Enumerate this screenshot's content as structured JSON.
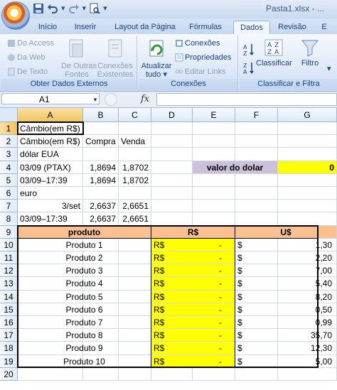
{
  "window": {
    "title": "Pasta1.xlsx - ..."
  },
  "quick_access": {
    "save_icon": "save-icon",
    "undo_icon": "undo-icon",
    "redo_icon": "redo-icon",
    "preview_icon": "print-preview-icon",
    "more_icon": "chevron-down-icon"
  },
  "tabs": [
    {
      "label": "Início"
    },
    {
      "label": "Inserir"
    },
    {
      "label": "Layout da Página"
    },
    {
      "label": "Fórmulas"
    },
    {
      "label": "Dados"
    },
    {
      "label": "Revisão"
    },
    {
      "label": "E"
    }
  ],
  "ribbon": {
    "group1": {
      "label": "Obter Dados Externos",
      "access": "Do Access",
      "web": "Da Web",
      "text": "De Texto",
      "other_line1": "De Outras",
      "other_line2": "Fontes",
      "existing_line1": "Conexões",
      "existing_line2": "Existentes"
    },
    "group2": {
      "label": "Conexões",
      "refresh_line1": "Atualizar",
      "refresh_line2": "tudo",
      "connections": "Conexões",
      "properties": "Propriedades",
      "edit_links": "Editar Links"
    },
    "group3": {
      "label": "Classificar e Filtra",
      "sort": "Classificar",
      "filter": "Filtro"
    }
  },
  "formula_bar": {
    "name_box": "A1",
    "fx": "fx",
    "formula": ""
  },
  "columns": [
    "A",
    "B",
    "C",
    "D",
    "E",
    "F",
    "G"
  ],
  "rows": [
    "1",
    "2",
    "3",
    "4",
    "5",
    "6",
    "7",
    "8",
    "9",
    "10",
    "11",
    "12",
    "13",
    "14",
    "15",
    "16",
    "17",
    "18",
    "19",
    "20"
  ],
  "sheet": {
    "a1": "Câmbio(em R$)",
    "a2": "Câmbio(em R$)",
    "b2": "Compra",
    "c2": "Venda",
    "a3": "dólar EUA",
    "a4": "03/09 (PTAX)",
    "b4": "1,8694",
    "c4": "1,8702",
    "a5": "03/09–17:39",
    "b5": "1,8694",
    "c5": "1,8702",
    "a6": "euro",
    "a7": "3/set",
    "b7": "2,6637",
    "c7": "2,6651",
    "a8": "03/09–17:39",
    "b8": "2,6637",
    "c8": "2,6651",
    "e4": "valor do dolar",
    "g4": "0"
  },
  "table": {
    "headers": [
      "produto",
      "R$",
      "U$"
    ],
    "rows": [
      {
        "produto": "Produto 1",
        "rs": "R$",
        "rs_val": "-",
        "us": "$",
        "us_val": "1,30"
      },
      {
        "produto": "Produto 2",
        "rs": "R$",
        "rs_val": "-",
        "us": "$",
        "us_val": "2,20"
      },
      {
        "produto": "Produto 3",
        "rs": "R$",
        "rs_val": "-",
        "us": "$",
        "us_val": "7,00"
      },
      {
        "produto": "Produto 4",
        "rs": "R$",
        "rs_val": "-",
        "us": "$",
        "us_val": "5,40"
      },
      {
        "produto": "Produto 5",
        "rs": "R$",
        "rs_val": "-",
        "us": "$",
        "us_val": "8,20"
      },
      {
        "produto": "Produto 6",
        "rs": "R$",
        "rs_val": "-",
        "us": "$",
        "us_val": "0,50"
      },
      {
        "produto": "Produto 7",
        "rs": "R$",
        "rs_val": "-",
        "us": "$",
        "us_val": "0,99"
      },
      {
        "produto": "Produto 8",
        "rs": "R$",
        "rs_val": "-",
        "us": "$",
        "us_val": "35,70"
      },
      {
        "produto": "Produto 9",
        "rs": "R$",
        "rs_val": "-",
        "us": "$",
        "us_val": "12,30"
      },
      {
        "produto": "Produto 10",
        "rs": "R$",
        "rs_val": "-",
        "us": "$",
        "us_val": "5,00"
      }
    ]
  },
  "colors": {
    "header_fill": "#fac090",
    "rs_fill": "#ffff00",
    "label_fill": "#ccc0da",
    "value_fill": "#ffff00"
  }
}
